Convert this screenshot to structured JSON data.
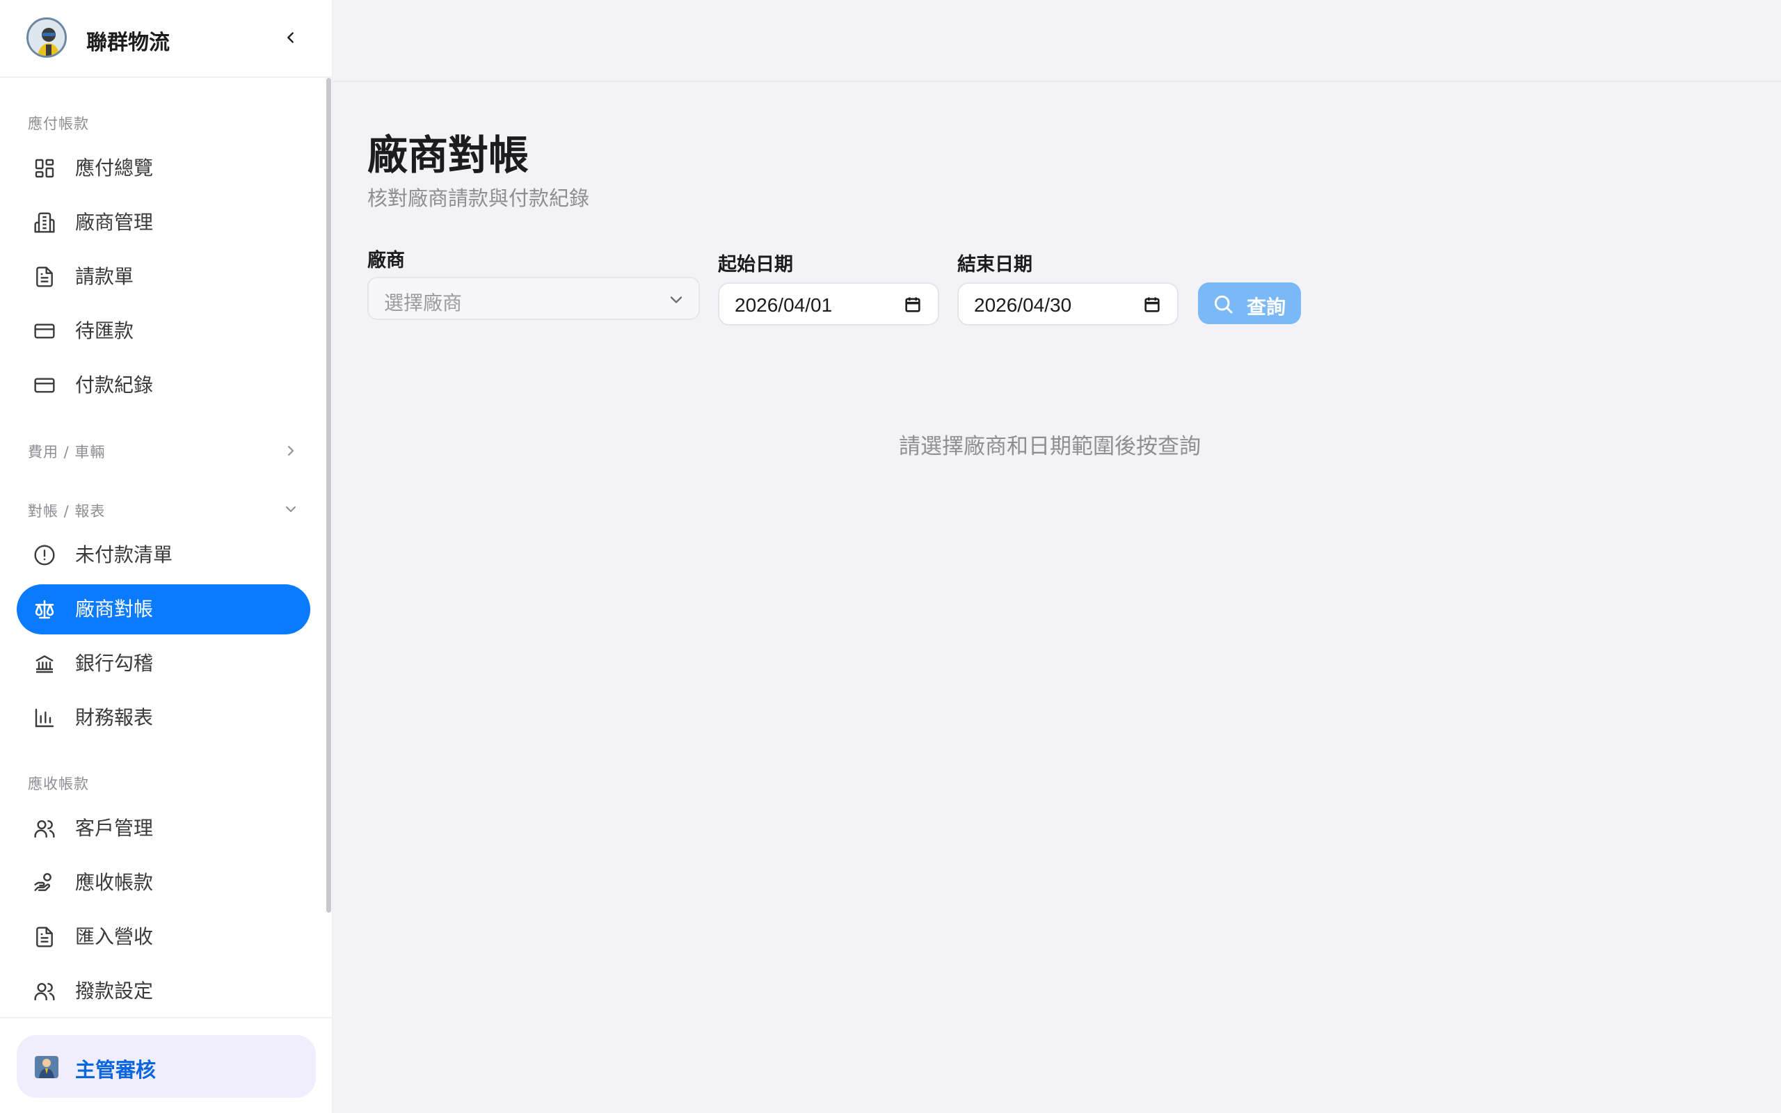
{
  "brand": {
    "name": "聯群物流"
  },
  "sidebar": {
    "sections": [
      {
        "label": "應付帳款"
      },
      {
        "label": "費用 / 車輛"
      },
      {
        "label": "對帳 / 報表"
      },
      {
        "label": "應收帳款"
      }
    ],
    "items": [
      {
        "label": "應付總覽",
        "icon": "grid-icon"
      },
      {
        "label": "廠商管理",
        "icon": "building-icon"
      },
      {
        "label": "請款單",
        "icon": "document-icon"
      },
      {
        "label": "待匯款",
        "icon": "card-icon"
      },
      {
        "label": "付款紀錄",
        "icon": "card-icon"
      },
      {
        "label": "未付款清單",
        "icon": "alert-circle-icon"
      },
      {
        "label": "廠商對帳",
        "icon": "scale-icon",
        "active": true
      },
      {
        "label": "銀行勾稽",
        "icon": "bank-icon"
      },
      {
        "label": "財務報表",
        "icon": "bar-chart-icon"
      },
      {
        "label": "客戶管理",
        "icon": "users-icon"
      },
      {
        "label": "應收帳款",
        "icon": "hand-coins-icon"
      },
      {
        "label": "匯入營收",
        "icon": "document-icon"
      },
      {
        "label": "撥款設定",
        "icon": "users-icon"
      }
    ],
    "user": {
      "label": "主管審核",
      "icon": "manager-avatar-icon"
    }
  },
  "main": {
    "title": "廠商對帳",
    "subtitle": "核對廠商請款與付款紀錄",
    "filters": {
      "vendor_label": "廠商",
      "vendor_placeholder": "選擇廠商",
      "start_label": "起始日期",
      "start_value": "2026/04/01",
      "end_label": "結束日期",
      "end_value": "2026/04/30",
      "query_label": "查詢"
    },
    "empty_message": "請選擇廠商和日期範圍後按查詢"
  },
  "colors": {
    "accent": "#0a7aff",
    "query_button": "#7ab8f7",
    "background": "#f2f2f7",
    "sidebar": "#ffffff"
  }
}
